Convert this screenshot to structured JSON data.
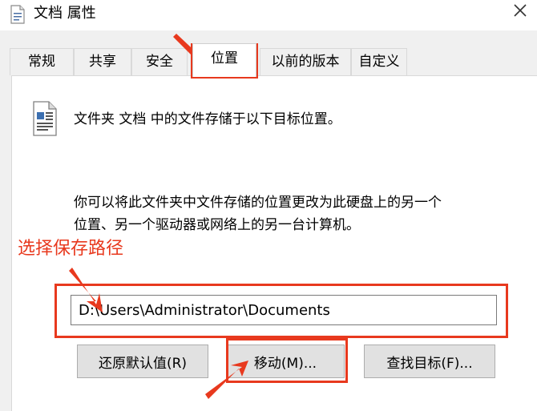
{
  "window": {
    "title": "文档 属性",
    "close_icon": "close-icon",
    "folder_icon": "document-folder-icon"
  },
  "tabs": [
    {
      "label": "常规",
      "active": false
    },
    {
      "label": "共享",
      "active": false
    },
    {
      "label": "安全",
      "active": false
    },
    {
      "label": "位置",
      "active": true
    },
    {
      "label": "以前的版本",
      "active": false
    },
    {
      "label": "自定义",
      "active": false
    }
  ],
  "location": {
    "heading": "文件夹 文档 中的文件存储于以下目标位置。",
    "description_line1": "你可以将此文件夹中文件存储的位置更改为此硬盘上的另一个",
    "description_line2": "位置、另一个驱动器或网络上的另一台计算机。",
    "path_value": "D:\\Users\\Administrator\\Documents"
  },
  "buttons": {
    "restore_default": "还原默认值(R)",
    "move": "移动(M)...",
    "find_target": "查找目标(F)..."
  },
  "annotation": {
    "text": "选择保存路径",
    "color": "#e8391e"
  }
}
